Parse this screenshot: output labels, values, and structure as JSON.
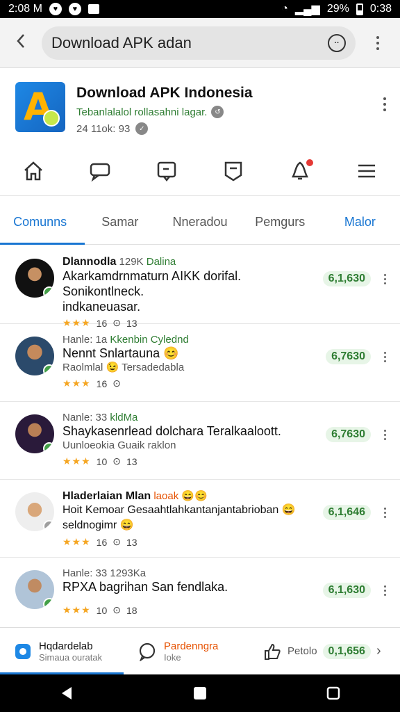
{
  "statusbar": {
    "time": "2:08 M",
    "battery": "29%",
    "clock": "0:38"
  },
  "urlbar": {
    "query": "Download APK adan"
  },
  "app": {
    "name": "Download APK Indonesia",
    "subtitle": "Tebanlalalol rollasahni lagar.",
    "meta": "24 11ok: 93"
  },
  "nav_icons": [
    "home-icon",
    "chat-icon",
    "message-icon",
    "bookmark-icon",
    "notification-icon",
    "menu-icon"
  ],
  "tabs": [
    {
      "label": "Comunns",
      "state": "active"
    },
    {
      "label": "Samar",
      "state": "normal"
    },
    {
      "label": "Nneradou",
      "state": "normal"
    },
    {
      "label": "Pemgurs",
      "state": "normal"
    },
    {
      "label": "Malor",
      "state": "highlight"
    }
  ],
  "rows": [
    {
      "name": "Dlannodla",
      "meta": "129K",
      "tag": "Dalina",
      "text": "Akarkamdrnmaturn AIKK dorifal. Sonikontlneck.",
      "sub": "indkaneuasar.",
      "rating": "16",
      "count": "13",
      "pill": "6,1,630"
    },
    {
      "name": "Hanle: 1a",
      "meta": "",
      "tag": "Kkenbin Cylednd",
      "text": "Nennt Snlartauna 😊",
      "sub": "Raolmlal 😉 Tersadedabla",
      "rating": "16",
      "count": "",
      "pill": "6,7630"
    },
    {
      "name": "Nanle: 33",
      "meta": "",
      "tag": "kldMa",
      "text": "Shaykasenrlead dolchara Teralkaaloott.",
      "sub": "Uunloeokia Guaik raklon",
      "rating": "10",
      "count": "13",
      "pill": "6,7630"
    },
    {
      "name": "Hladerlaian Mlan",
      "meta": "",
      "tag": "laoak 😄😊",
      "text": "Hoit Kemoar Gesaahtlahkantanjantabrioban 😄",
      "sub": "seldnogimr 😄",
      "rating": "16",
      "count": "13",
      "pill": "6,1,646"
    },
    {
      "name": "Hanle: 33 1293Ka",
      "meta": "",
      "tag": "",
      "text": "RPXA bagrihan San fendlaka.",
      "sub": "",
      "rating": "10",
      "count": "18",
      "pill": "6,1,630"
    }
  ],
  "bottombar": {
    "item1_title": "Hqdardelab",
    "item1_sub": "Simaua ouratak",
    "item2_title": "Pardenngra",
    "item2_sub": "Ioke",
    "item3_title": "Petolo",
    "item3_pill": "0,1,656"
  }
}
